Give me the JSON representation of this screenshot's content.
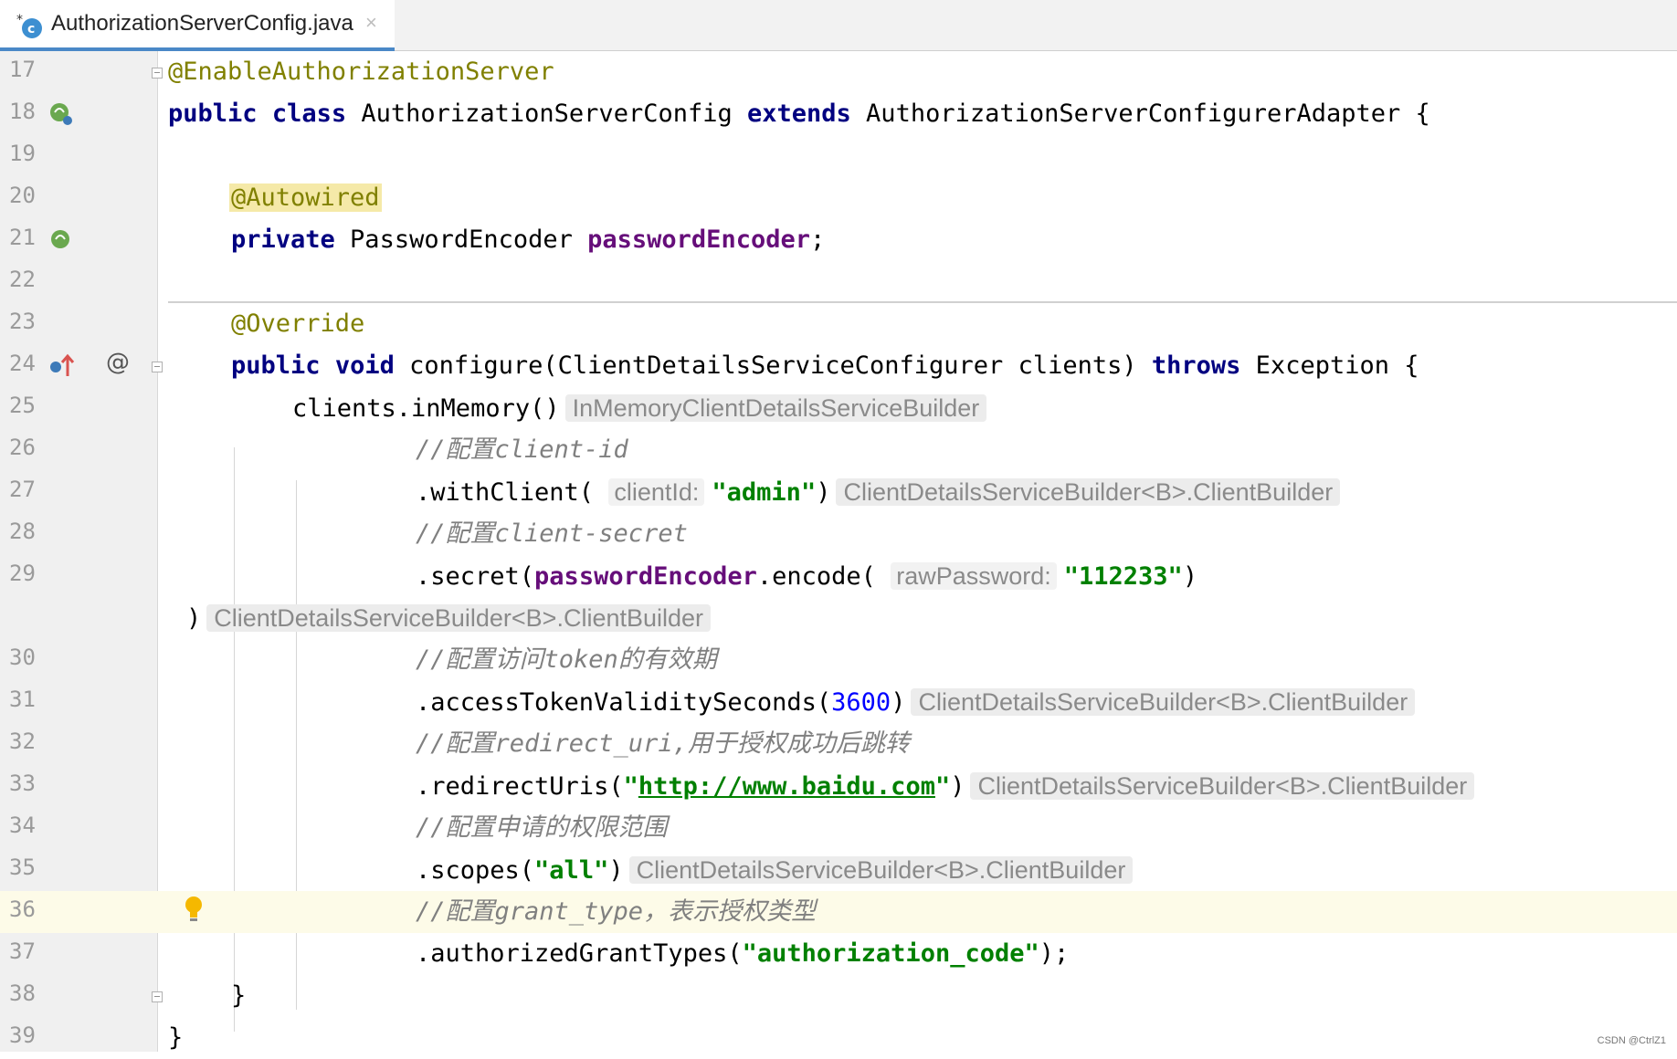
{
  "tab": {
    "title": "AuthorizationServerConfig.java",
    "close": "×",
    "icon": "java-class-icon"
  },
  "lines": [
    {
      "num": "17"
    },
    {
      "num": "18"
    },
    {
      "num": "19"
    },
    {
      "num": "20"
    },
    {
      "num": "21"
    },
    {
      "num": "22"
    },
    {
      "num": "23"
    },
    {
      "num": "24"
    },
    {
      "num": "25"
    },
    {
      "num": "26"
    },
    {
      "num": "27"
    },
    {
      "num": "28"
    },
    {
      "num": "29"
    },
    {
      "num": ""
    },
    {
      "num": "30"
    },
    {
      "num": "31"
    },
    {
      "num": "32"
    },
    {
      "num": "33"
    },
    {
      "num": "34"
    },
    {
      "num": "35"
    },
    {
      "num": "36"
    },
    {
      "num": "37"
    },
    {
      "num": "38"
    },
    {
      "num": "39"
    }
  ],
  "code": {
    "l17": {
      "a": "@EnableAuthorizationServer"
    },
    "l18": {
      "a": "public",
      "b": "class",
      "c": " AuthorizationServerConfig ",
      "d": "extends",
      "e": " AuthorizationServerConfigurerAdapter {"
    },
    "l20": {
      "a": "@Autowired"
    },
    "l21": {
      "a": "private",
      "b": " PasswordEncoder ",
      "c": "passwordEncoder",
      "d": ";"
    },
    "l23": {
      "a": "@Override"
    },
    "l24": {
      "a": "public",
      "b": "void",
      "c": " configure(ClientDetailsServiceConfigurer clients) ",
      "d": "throws",
      "e": " Exception {"
    },
    "l25": {
      "a": "clients.inMemory()",
      "hint": "InMemoryClientDetailsServiceBuilder"
    },
    "l26": {
      "a": "//配置client-id"
    },
    "l27": {
      "a": ".withClient(",
      "param": "clientId:",
      "str": "\"admin\"",
      "b": ")",
      "hint": "ClientDetailsServiceBuilder<B>.ClientBuilder"
    },
    "l28": {
      "a": "//配置client-secret"
    },
    "l29": {
      "a": ".secret(",
      "field": "passwordEncoder",
      "b": ".encode(",
      "param": "rawPassword:",
      "str": "\"112233\"",
      "c": ")"
    },
    "l29b": {
      "a": ")",
      "hint": "ClientDetailsServiceBuilder<B>.ClientBuilder"
    },
    "l30": {
      "a": "//配置访问token的有效期"
    },
    "l31": {
      "a": ".accessTokenValiditySeconds(",
      "num": "3600",
      "b": ")",
      "hint": "ClientDetailsServiceBuilder<B>.ClientBuilder"
    },
    "l32": {
      "a": "//配置redirect_uri,用于授权成功后跳转"
    },
    "l33": {
      "a": ".redirectUris(",
      "q1": "\"",
      "link": "http://www.baidu.com",
      "q2": "\"",
      "b": ")",
      "hint": "ClientDetailsServiceBuilder<B>.ClientBuilder"
    },
    "l34": {
      "a": "//配置申请的权限范围"
    },
    "l35": {
      "a": ".scopes(",
      "str": "\"all\"",
      "b": ")",
      "hint": "ClientDetailsServiceBuilder<B>.ClientBuilder"
    },
    "l36": {
      "a": "//配置grant_type，表示授权类型"
    },
    "l37": {
      "a": ".authorizedGrantTypes(",
      "str": "\"authorization_code\"",
      "b": ");"
    },
    "l38": {
      "a": "}"
    },
    "l39": {
      "a": "}"
    }
  },
  "gutter_icons": {
    "l18": "spring-bean-icon",
    "l21": "spring-bean-icon",
    "l24": "override-method-icon",
    "l24_at": "@",
    "l36": "lightbulb-icon"
  },
  "watermark": "CSDN @CtrlZ1"
}
